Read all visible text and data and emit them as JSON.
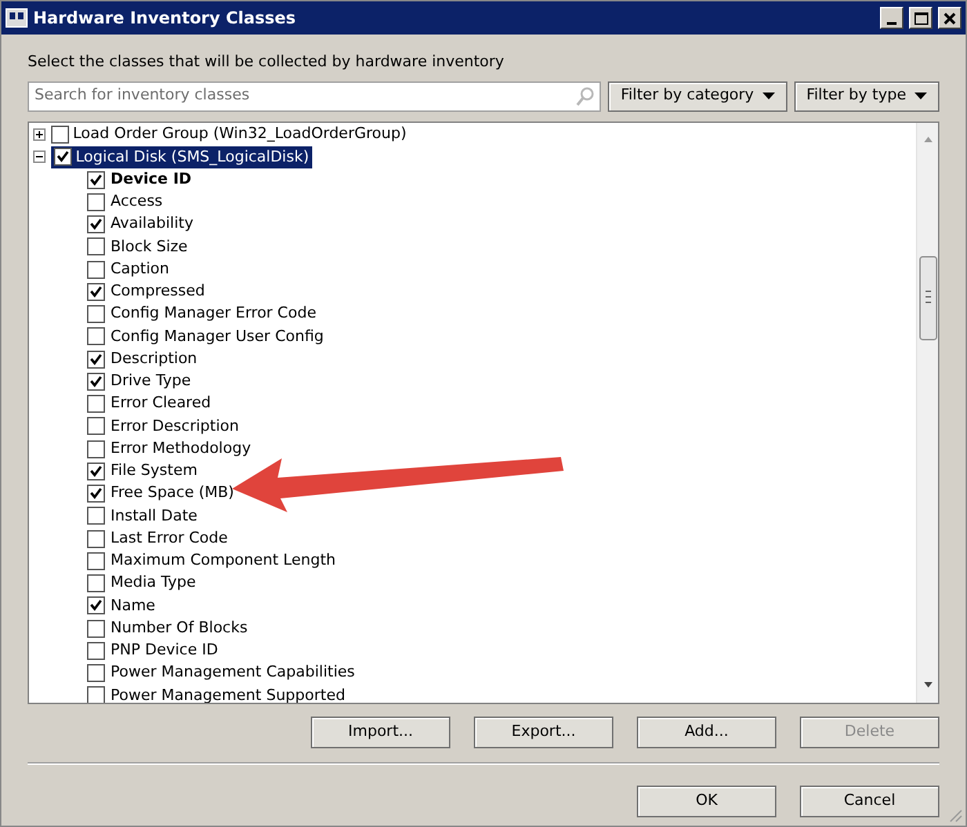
{
  "window": {
    "title": "Hardware Inventory Classes"
  },
  "instruction": "Select the classes that will be collected by hardware inventory",
  "search": {
    "placeholder": "Search for inventory classes"
  },
  "filters": [
    "Filter by category",
    "Filter by type"
  ],
  "tree": [
    {
      "label": "Load Order Group (Win32_LoadOrderGroup)",
      "expanded": false,
      "checked": false,
      "selected": false
    },
    {
      "label": "Logical Disk (SMS_LogicalDisk)",
      "expanded": true,
      "checked": true,
      "selected": true,
      "children": [
        {
          "label": "Device ID",
          "checked": true,
          "key": true
        },
        {
          "label": "Access",
          "checked": false,
          "key": false
        },
        {
          "label": "Availability",
          "checked": true,
          "key": false
        },
        {
          "label": "Block Size",
          "checked": false,
          "key": false
        },
        {
          "label": "Caption",
          "checked": false,
          "key": false
        },
        {
          "label": "Compressed",
          "checked": true,
          "key": false
        },
        {
          "label": "Config Manager Error Code",
          "checked": false,
          "key": false
        },
        {
          "label": "Config Manager User Config",
          "checked": false,
          "key": false
        },
        {
          "label": "Description",
          "checked": true,
          "key": false
        },
        {
          "label": "Drive Type",
          "checked": true,
          "key": false
        },
        {
          "label": "Error Cleared",
          "checked": false,
          "key": false
        },
        {
          "label": "Error Description",
          "checked": false,
          "key": false
        },
        {
          "label": "Error Methodology",
          "checked": false,
          "key": false
        },
        {
          "label": "File System",
          "checked": true,
          "key": false
        },
        {
          "label": "Free Space (MB)",
          "checked": true,
          "key": false
        },
        {
          "label": "Install Date",
          "checked": false,
          "key": false
        },
        {
          "label": "Last Error Code",
          "checked": false,
          "key": false
        },
        {
          "label": "Maximum Component Length",
          "checked": false,
          "key": false
        },
        {
          "label": "Media Type",
          "checked": false,
          "key": false
        },
        {
          "label": "Name",
          "checked": true,
          "key": false
        },
        {
          "label": "Number Of Blocks",
          "checked": false,
          "key": false
        },
        {
          "label": "PNP Device ID",
          "checked": false,
          "key": false
        },
        {
          "label": "Power Management Capabilities",
          "checked": false,
          "key": false
        },
        {
          "label": "Power Management Supported",
          "checked": false,
          "key": false
        }
      ]
    }
  ],
  "actions": [
    {
      "label": "Import...",
      "disabled": false
    },
    {
      "label": "Export...",
      "disabled": false
    },
    {
      "label": "Add...",
      "disabled": false
    },
    {
      "label": "Delete",
      "disabled": true
    }
  ],
  "dialog_buttons": [
    "OK",
    "Cancel"
  ]
}
